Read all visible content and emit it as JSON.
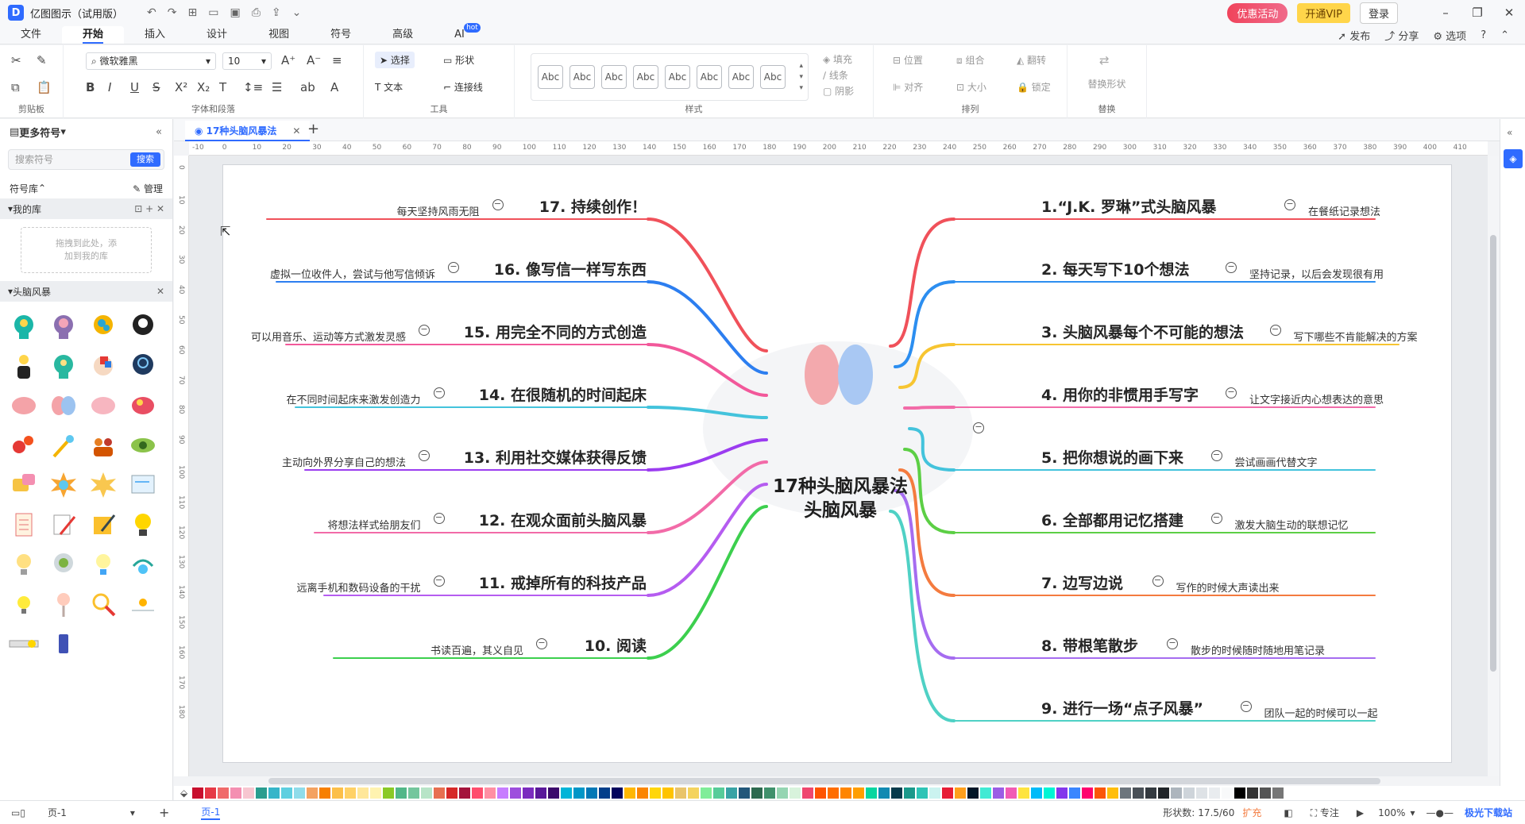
{
  "app": {
    "title": "亿图图示（试用版）",
    "logo_letter": "D"
  },
  "titlebar": {
    "promo": "优惠活动",
    "vip": "开通VIP",
    "login": "登录"
  },
  "menu": {
    "items": [
      "文件",
      "开始",
      "插入",
      "设计",
      "视图",
      "符号",
      "高级",
      "AI"
    ],
    "active": "开始",
    "ai_badge": "hot",
    "right": [
      "发布",
      "分享",
      "选项"
    ]
  },
  "ribbon": {
    "groups": {
      "clipboard": "剪贴板",
      "font": "字体和段落",
      "tools": "工具",
      "styles": "样式",
      "arrange": "排列",
      "replace": "替换"
    },
    "font_name": "微软雅黑",
    "font_size": "10",
    "tools": {
      "select": "选择",
      "shape": "形状",
      "text": "文本",
      "connector": "连接线"
    },
    "style_sample": "Abc",
    "fill": {
      "fill": "填充",
      "line": "线条",
      "shadow": "阴影"
    },
    "arrange": {
      "position": "位置",
      "group": "组合",
      "flip": "翻转",
      "align": "对齐",
      "size": "大小",
      "lock": "锁定"
    },
    "replace_shape": "替换形状"
  },
  "sidebar": {
    "title": "更多符号",
    "search_placeholder": "搜索符号",
    "search_button": "搜索",
    "library_label": "符号库",
    "manage_label": "管理",
    "my_library": "我的库",
    "drop_hint_1": "拖拽到此处，添",
    "drop_hint_2": "加到我的库",
    "category": "头脑风暴"
  },
  "document": {
    "tab_name": "17种头脑风暴法"
  },
  "rulers": {
    "h_labels": [
      "-10",
      "0",
      "10",
      "20",
      "30",
      "40",
      "50",
      "60",
      "70",
      "80",
      "90",
      "100",
      "110",
      "120",
      "130",
      "140",
      "150",
      "160",
      "170",
      "180",
      "190",
      "200",
      "210",
      "220",
      "230",
      "240",
      "250",
      "260",
      "270",
      "280",
      "290",
      "300",
      "310",
      "320",
      "330",
      "340",
      "350",
      "360",
      "370",
      "380",
      "390",
      "400",
      "410"
    ],
    "v_labels": [
      "0",
      "10",
      "20",
      "30",
      "40",
      "50",
      "60",
      "70",
      "80",
      "90",
      "100",
      "110",
      "120",
      "130",
      "140",
      "150",
      "160",
      "170",
      "180"
    ]
  },
  "mindmap": {
    "center_line1": "17种头脑风暴法",
    "center_line2": "头脑风暴",
    "right_nodes": [
      {
        "title": "1.“J.K. 罗琳”式头脑风暴",
        "note": "在餐纸记录想法",
        "color": "#f0515a"
      },
      {
        "title": "2. 每天写下10个想法",
        "note": "坚持记录，以后会发现很有用",
        "color": "#2c8ef0"
      },
      {
        "title": "3. 头脑风暴每个不可能的想法",
        "note": "写下哪些不肯能解决的方案",
        "color": "#f7c531"
      },
      {
        "title": "4. 用你的非惯用手写字",
        "note": "让文字接近内心想表达的意思",
        "color": "#f26ba8"
      },
      {
        "title": "5. 把你想说的画下来",
        "note": "尝试画画代替文字",
        "color": "#43c3dc"
      },
      {
        "title": "6. 全部都用记忆搭建",
        "note": "激发大脑生动的联想记忆",
        "color": "#5ccf45"
      },
      {
        "title": "7. 边写边说",
        "note": "写作的时候大声读出来",
        "color": "#f47b3f"
      },
      {
        "title": "8. 带根笔散步",
        "note": "散步的时候随时随地用笔记录",
        "color": "#a56cf0"
      },
      {
        "title": "9. 进行一场“点子风暴”",
        "note": "团队一起的时候可以一起",
        "color": "#4fd1c5"
      }
    ],
    "left_nodes": [
      {
        "title": "17. 持续创作！",
        "note": "每天坚持风雨无阻",
        "color": "#f0515a"
      },
      {
        "title": "16. 像写信一样写东西",
        "note": "虚拟一位收件人，尝试与他写信倾诉",
        "color": "#2c7ef0"
      },
      {
        "title": "15. 用完全不同的方式创造",
        "note": "可以用音乐、运动等方式激发灵感",
        "color": "#f2589a"
      },
      {
        "title": "14. 在很随机的时间起床",
        "note": "在不同时间起床来激发创造力",
        "color": "#43c3dc"
      },
      {
        "title": "13. 利用社交媒体获得反馈",
        "note": "主动向外界分享自己的想法",
        "color": "#9b3cf0"
      },
      {
        "title": "12. 在观众面前头脑风暴",
        "note": "将想法样式给朋友们",
        "color": "#f26ba8"
      },
      {
        "title": "11. 戒掉所有的科技产品",
        "note": "远离手机和数码设备的干扰",
        "color": "#b55cf0"
      },
      {
        "title": "10. 阅读",
        "note": "书读百遍，其义自见",
        "color": "#3ccf4e"
      }
    ]
  },
  "palette": [
    "#c8102e",
    "#e63946",
    "#f06a6a",
    "#f48fb1",
    "#f7c6d0",
    "#2a9d8f",
    "#36b5c9",
    "#5ecfe0",
    "#8fdcea",
    "#f4a261",
    "#f77f00",
    "#fcbf49",
    "#ffd166",
    "#ffe79a",
    "#fff3b0",
    "#8ac926",
    "#52b788",
    "#74c69d",
    "#b7e4c7",
    "#e76f51",
    "#d62828",
    "#a4133c",
    "#ff4d6d",
    "#ff8fa3",
    "#c77dff",
    "#9d4edd",
    "#7b2cbf",
    "#5a189a",
    "#3c096c",
    "#00b4d8",
    "#0096c7",
    "#0077b6",
    "#023e8a",
    "#03045e",
    "#ffb703",
    "#fb8500",
    "#ffd60a",
    "#ffc300",
    "#e9c46a",
    "#f4d35e",
    "#80ed99",
    "#57cc99",
    "#38a3a5",
    "#22577a",
    "#2d6a4f",
    "#40916c",
    "#95d5b2",
    "#d8f3dc",
    "#ef476f",
    "#ff5400",
    "#ff6d00",
    "#ff8500",
    "#ff9e00",
    "#06d6a0",
    "#118ab2",
    "#073b4c",
    "#1b998b",
    "#2ec4b6",
    "#cbf3f0",
    "#e71d36",
    "#ff9f1c",
    "#011627",
    "#41ead4",
    "#9b5de5",
    "#f15bb5",
    "#fee440",
    "#00bbf9",
    "#00f5d4",
    "#8338ec",
    "#3a86ff",
    "#ff006e",
    "#fb5607",
    "#ffbe0b",
    "#6c757d",
    "#495057",
    "#343a40",
    "#212529",
    "#adb5bd",
    "#ced4da",
    "#dee2e6",
    "#e9ecef",
    "#f8f9fa",
    "#000000",
    "#333333",
    "#555555",
    "#777777"
  ],
  "status": {
    "page_tab_left": "页-1",
    "page_tab_active": "页-1",
    "shape_count_label": "形状数:",
    "shape_count": "17.5/60",
    "expand": "扩充",
    "focus": "专注",
    "zoom": "100%"
  },
  "watermark": "极光下载站"
}
